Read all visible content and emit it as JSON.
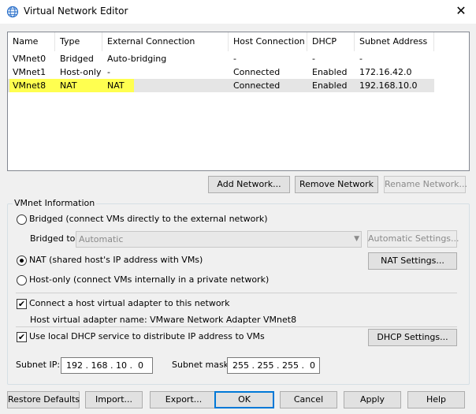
{
  "window": {
    "title": "Virtual Network Editor",
    "close_glyph": "✕"
  },
  "list": {
    "columns": [
      "Name",
      "Type",
      "External Connection",
      "Host Connection",
      "DHCP",
      "Subnet Address"
    ],
    "rows": [
      {
        "name": "VMnet0",
        "type": "Bridged",
        "external": "Auto-bridging",
        "host": "-",
        "dhcp": "-",
        "subnet": "-"
      },
      {
        "name": "VMnet1",
        "type": "Host-only",
        "external": "-",
        "host": "Connected",
        "dhcp": "Enabled",
        "subnet": "172.16.42.0"
      },
      {
        "name": "VMnet8",
        "type": "NAT",
        "external": "NAT",
        "host": "Connected",
        "dhcp": "Enabled",
        "subnet": "192.168.10.0"
      }
    ]
  },
  "list_buttons": {
    "add": "Add Network...",
    "remove": "Remove Network",
    "rename": "Rename Network..."
  },
  "vmnet_info": {
    "legend": "VMnet Information",
    "bridged_label": "Bridged (connect VMs directly to the external network)",
    "bridged_to_label": "Bridged to:",
    "bridged_to_value": "Automatic",
    "auto_settings": "Automatic Settings...",
    "nat_label": "NAT (shared host's IP address with VMs)",
    "nat_settings": "NAT Settings...",
    "hostonly_label": "Host-only (connect VMs internally in a private network)",
    "connect_adapter_label": "Connect a host virtual adapter to this network",
    "adapter_name_label": "Host virtual adapter name: VMware Network Adapter VMnet8",
    "dhcp_label": "Use local DHCP service to distribute IP address to VMs",
    "dhcp_settings": "DHCP Settings...",
    "subnet_ip_label": "Subnet IP:",
    "subnet_ip_value": "192 . 168 . 10 .  0",
    "subnet_mask_label": "Subnet mask:",
    "subnet_mask_value": "255 . 255 . 255 .  0",
    "selected_mode": "nat",
    "connect_adapter_checked": true,
    "dhcp_checked": true
  },
  "bottom_buttons": {
    "restore": "Restore Defaults",
    "import": "Import...",
    "export": "Export...",
    "ok": "OK",
    "cancel": "Cancel",
    "apply": "Apply",
    "help": "Help"
  },
  "colors": {
    "highlight": "#ffff50",
    "selected_row": "#e5e5e5",
    "focus_border": "#0078d7"
  },
  "icons": {
    "title": "network-globe-icon",
    "check": "✔"
  }
}
